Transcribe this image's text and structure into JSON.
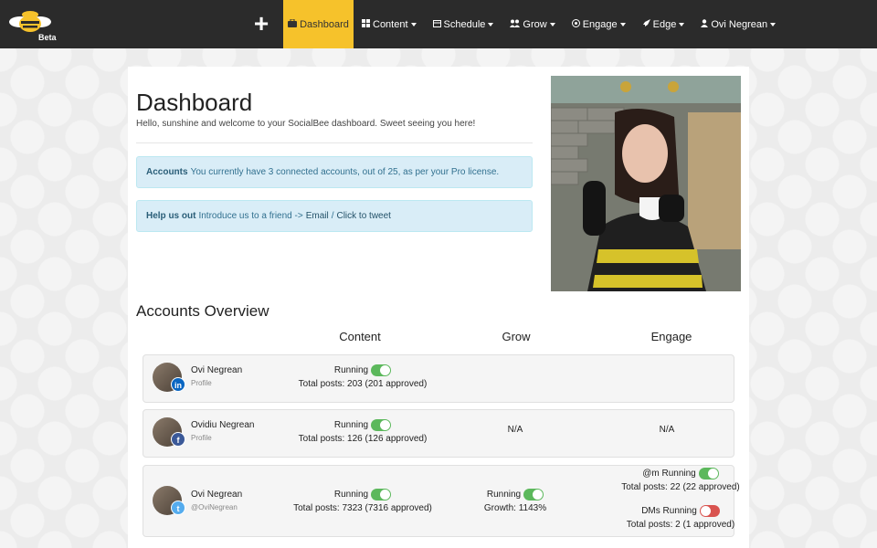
{
  "navbar": {
    "logo_badge": "Beta",
    "add_label": "+",
    "items": [
      {
        "label": "Dashboard",
        "icon": "briefcase-icon",
        "active": true
      },
      {
        "label": "Content",
        "icon": "grid-icon"
      },
      {
        "label": "Schedule",
        "icon": "calendar-icon"
      },
      {
        "label": "Grow",
        "icon": "users-icon"
      },
      {
        "label": "Engage",
        "icon": "at-icon"
      },
      {
        "label": "Edge",
        "icon": "rocket-icon"
      },
      {
        "label": "Ovi Negrean",
        "icon": "user-icon"
      }
    ],
    "colors": {
      "bar": "#2b2b2b",
      "active": "#f6c22b"
    }
  },
  "page": {
    "title": "Dashboard",
    "subtitle": "Hello, sunshine and welcome to your SocialBee dashboard. Sweet seeing you here!"
  },
  "alerts": {
    "accounts": {
      "label": "Accounts",
      "text": "You currently have 3 connected accounts, out of 25, as per your Pro license."
    },
    "help": {
      "label": "Help us out",
      "text": "Introduce us to a friend ->",
      "email_link": "Email",
      "separator": "/",
      "tweet_link": "Click to tweet"
    }
  },
  "overview": {
    "title": "Accounts Overview",
    "columns": [
      "Content",
      "Grow",
      "Engage"
    ],
    "accounts": [
      {
        "name": "Ovi Negrean",
        "sub": "Profile",
        "network": "linkedin-icon",
        "badge": "in",
        "content_status": "Running",
        "content_posts": "Total posts: 203 (201 approved)"
      },
      {
        "name": "Ovidiu Negrean",
        "sub": "Profile",
        "network": "facebook-icon",
        "badge": "f",
        "content_status": "Running",
        "content_posts": "Total posts: 126 (126 approved)",
        "grow": "N/A",
        "engage": "N/A"
      },
      {
        "name": "Ovi Negrean",
        "sub": "@OviNegrean",
        "network": "twitter-icon",
        "badge": "t",
        "content_status": "Running",
        "content_posts": "Total posts: 7323 (7316 approved)",
        "grow_status": "Running",
        "grow_detail": "Growth: 1143%",
        "mentions_status": "@m Running",
        "mentions_posts": "Total posts: 22 (22 approved)",
        "dms_status": "DMs Running",
        "dms_posts": "Total posts: 2 (1 approved)"
      }
    ]
  }
}
